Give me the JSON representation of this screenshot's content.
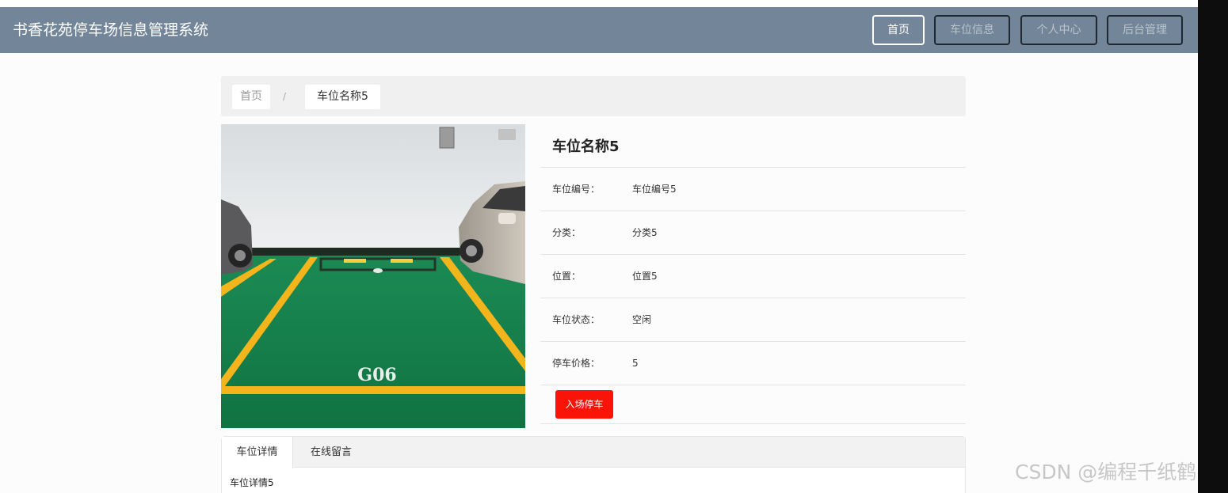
{
  "header": {
    "brand": "书香花苑停车场信息管理系统",
    "nav": [
      "首页",
      "车位信息",
      "个人中心",
      "后台管理"
    ]
  },
  "breadcrumb": {
    "home": "首页",
    "separator": "/",
    "current": "车位名称5"
  },
  "photo": {
    "label": "G06"
  },
  "detail": {
    "title": "车位名称5",
    "rows": [
      {
        "label": "车位编号：",
        "value": "车位编号5"
      },
      {
        "label": "分类：",
        "value": "分类5"
      },
      {
        "label": "位置：",
        "value": "位置5"
      },
      {
        "label": "车位状态：",
        "value": "空闲"
      },
      {
        "label": "停车价格：",
        "value": "5"
      }
    ],
    "action": "入场停车"
  },
  "tabs": {
    "items": [
      "车位详情",
      "在线留言"
    ],
    "content": "车位详情5"
  },
  "watermark": "CSDN @编程千纸鹤",
  "colors": {
    "navbar": "#738699",
    "action": "#fa1408"
  }
}
